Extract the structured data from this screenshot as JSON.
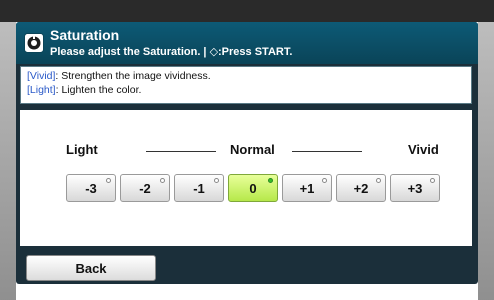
{
  "header": {
    "title": "Saturation",
    "subtitle": "Please adjust the Saturation. | ◇:Press START.",
    "icon": "copy-settings-icon"
  },
  "info": {
    "lines": [
      {
        "key": "[Vivid]",
        "text": ": Strengthen the image vividness."
      },
      {
        "key": "[Light]",
        "text": ": Lighten the color."
      }
    ]
  },
  "scale": {
    "left_label": "Light",
    "center_label": "Normal",
    "right_label": "Vivid"
  },
  "levels": {
    "selected": "0",
    "buttons": [
      {
        "label": "-3"
      },
      {
        "label": "-2"
      },
      {
        "label": "-1"
      },
      {
        "label": "0"
      },
      {
        "label": "+1"
      },
      {
        "label": "+2"
      },
      {
        "label": "+3"
      }
    ]
  },
  "footer": {
    "back_label": "Back"
  },
  "colors": {
    "header_bg": "#0d5a76",
    "panel_bg": "#1b2f3a",
    "selected_btn": "#b6e84a",
    "selected_led": "#35c02a",
    "info_key": "#2a59c8"
  }
}
